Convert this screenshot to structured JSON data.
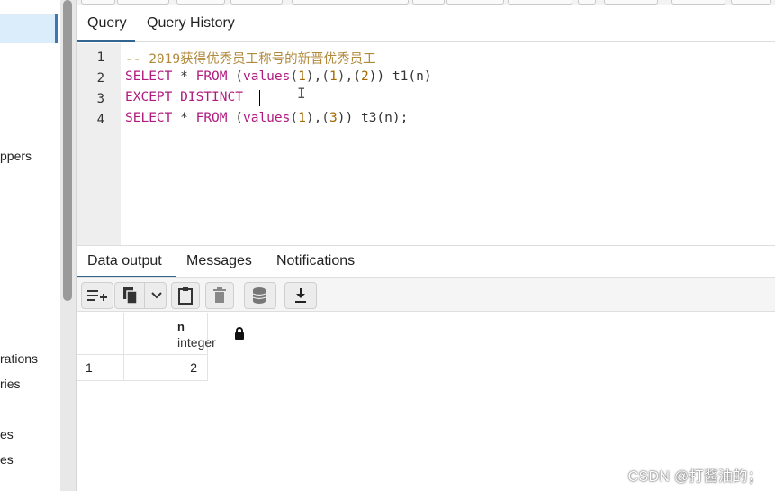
{
  "left_tree": {
    "fragments": [
      "ppers",
      "rations",
      "ries",
      "es",
      "es"
    ]
  },
  "query_tabs": [
    {
      "label": "Query"
    },
    {
      "label": "Query History"
    }
  ],
  "editor": {
    "line_numbers": [
      "1",
      "2",
      "3",
      "4"
    ],
    "lines": [
      [
        {
          "t": "-- 2019获得优秀员工称号的新晋优秀员工",
          "c": "comment"
        }
      ],
      [
        {
          "t": "SELECT",
          "c": "kw"
        },
        {
          "t": " * ",
          "c": "plain"
        },
        {
          "t": "FROM",
          "c": "kw"
        },
        {
          "t": " (",
          "c": "paren"
        },
        {
          "t": "values",
          "c": "kw"
        },
        {
          "t": "(",
          "c": "paren"
        },
        {
          "t": "1",
          "c": "num"
        },
        {
          "t": "),(",
          "c": "paren"
        },
        {
          "t": "1",
          "c": "num"
        },
        {
          "t": "),(",
          "c": "paren"
        },
        {
          "t": "2",
          "c": "num"
        },
        {
          "t": ")) t1(n)",
          "c": "plain"
        }
      ],
      [
        {
          "t": "EXCEPT DISTINCT",
          "c": "kw"
        }
      ],
      [
        {
          "t": "SELECT",
          "c": "kw"
        },
        {
          "t": " * ",
          "c": "plain"
        },
        {
          "t": "FROM",
          "c": "kw"
        },
        {
          "t": " (",
          "c": "paren"
        },
        {
          "t": "values",
          "c": "kw"
        },
        {
          "t": "(",
          "c": "paren"
        },
        {
          "t": "1",
          "c": "num"
        },
        {
          "t": "),(",
          "c": "paren"
        },
        {
          "t": "3",
          "c": "num"
        },
        {
          "t": ")) t3(n);",
          "c": "plain"
        }
      ]
    ]
  },
  "result_tabs": [
    {
      "label": "Data output"
    },
    {
      "label": "Messages"
    },
    {
      "label": "Notifications"
    }
  ],
  "result_toolbar": {
    "icons": [
      "add-row-icon",
      "copy-icon",
      "dropdown-chevron-icon",
      "paste-icon",
      "delete-icon",
      "save-data-icon",
      "download-icon"
    ]
  },
  "grid": {
    "columns": [
      {
        "name": "n",
        "type": "integer"
      }
    ],
    "rows": [
      {
        "row_number": "1",
        "values": [
          "2"
        ]
      }
    ]
  },
  "watermark": "CSDN @打酱油的；",
  "colors": {
    "keyword": "#b01b7f",
    "number": "#a36b00",
    "comment": "#b08a3c",
    "tab_accent": "#326690",
    "selection": "#dbecfb"
  }
}
